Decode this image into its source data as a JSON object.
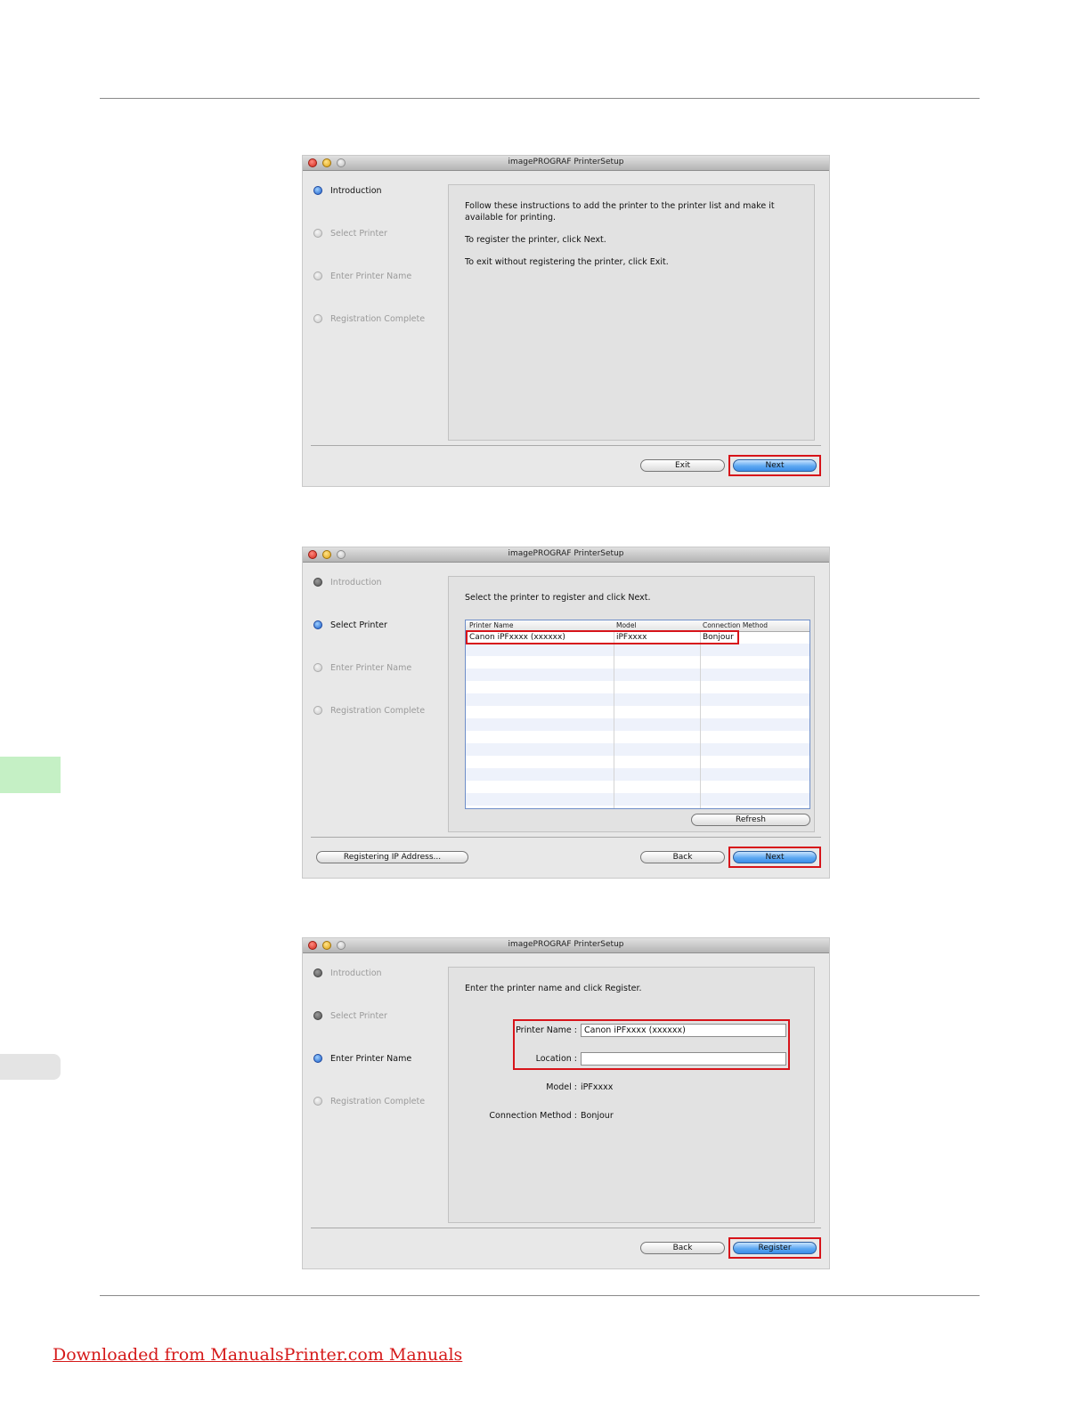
{
  "page": {
    "footer_link": "Downloaded from ManualsPrinter.com Manuals",
    "colors": {
      "accent_green": "#c5f0c5",
      "side_gray": "#e4e4e4",
      "highlight_red": "#d7141a"
    }
  },
  "app_title": "imagePROGRAF PrinterSetup",
  "steps": [
    "Introduction",
    "Select Printer",
    "Enter Printer Name",
    "Registration Complete"
  ],
  "window1": {
    "instructions": [
      "Follow these instructions to add the printer to the printer list and make it available for printing.",
      "To register the printer, click Next.",
      "To exit without registering the printer, click Exit."
    ],
    "exit_label": "Exit",
    "next_label": "Next"
  },
  "window2": {
    "instruction": "Select the printer to register and click Next.",
    "columns": [
      "Printer Name",
      "Model",
      "Connection Method"
    ],
    "rows": [
      {
        "printer_name": "Canon iPFxxxx (xxxxxx)",
        "model": "iPFxxxx",
        "connection": "Bonjour"
      }
    ],
    "refresh_label": "Refresh",
    "ip_label": "Registering IP Address...",
    "back_label": "Back",
    "next_label": "Next"
  },
  "window3": {
    "instruction": "Enter the printer name and click Register.",
    "printer_name_label": "Printer Name :",
    "printer_name_value": "Canon iPFxxxx (xxxxxx)",
    "location_label": "Location :",
    "location_value": "",
    "model_label": "Model :",
    "model_value": "iPFxxxx",
    "connection_label": "Connection Method :",
    "connection_value": "Bonjour",
    "back_label": "Back",
    "register_label": "Register"
  }
}
